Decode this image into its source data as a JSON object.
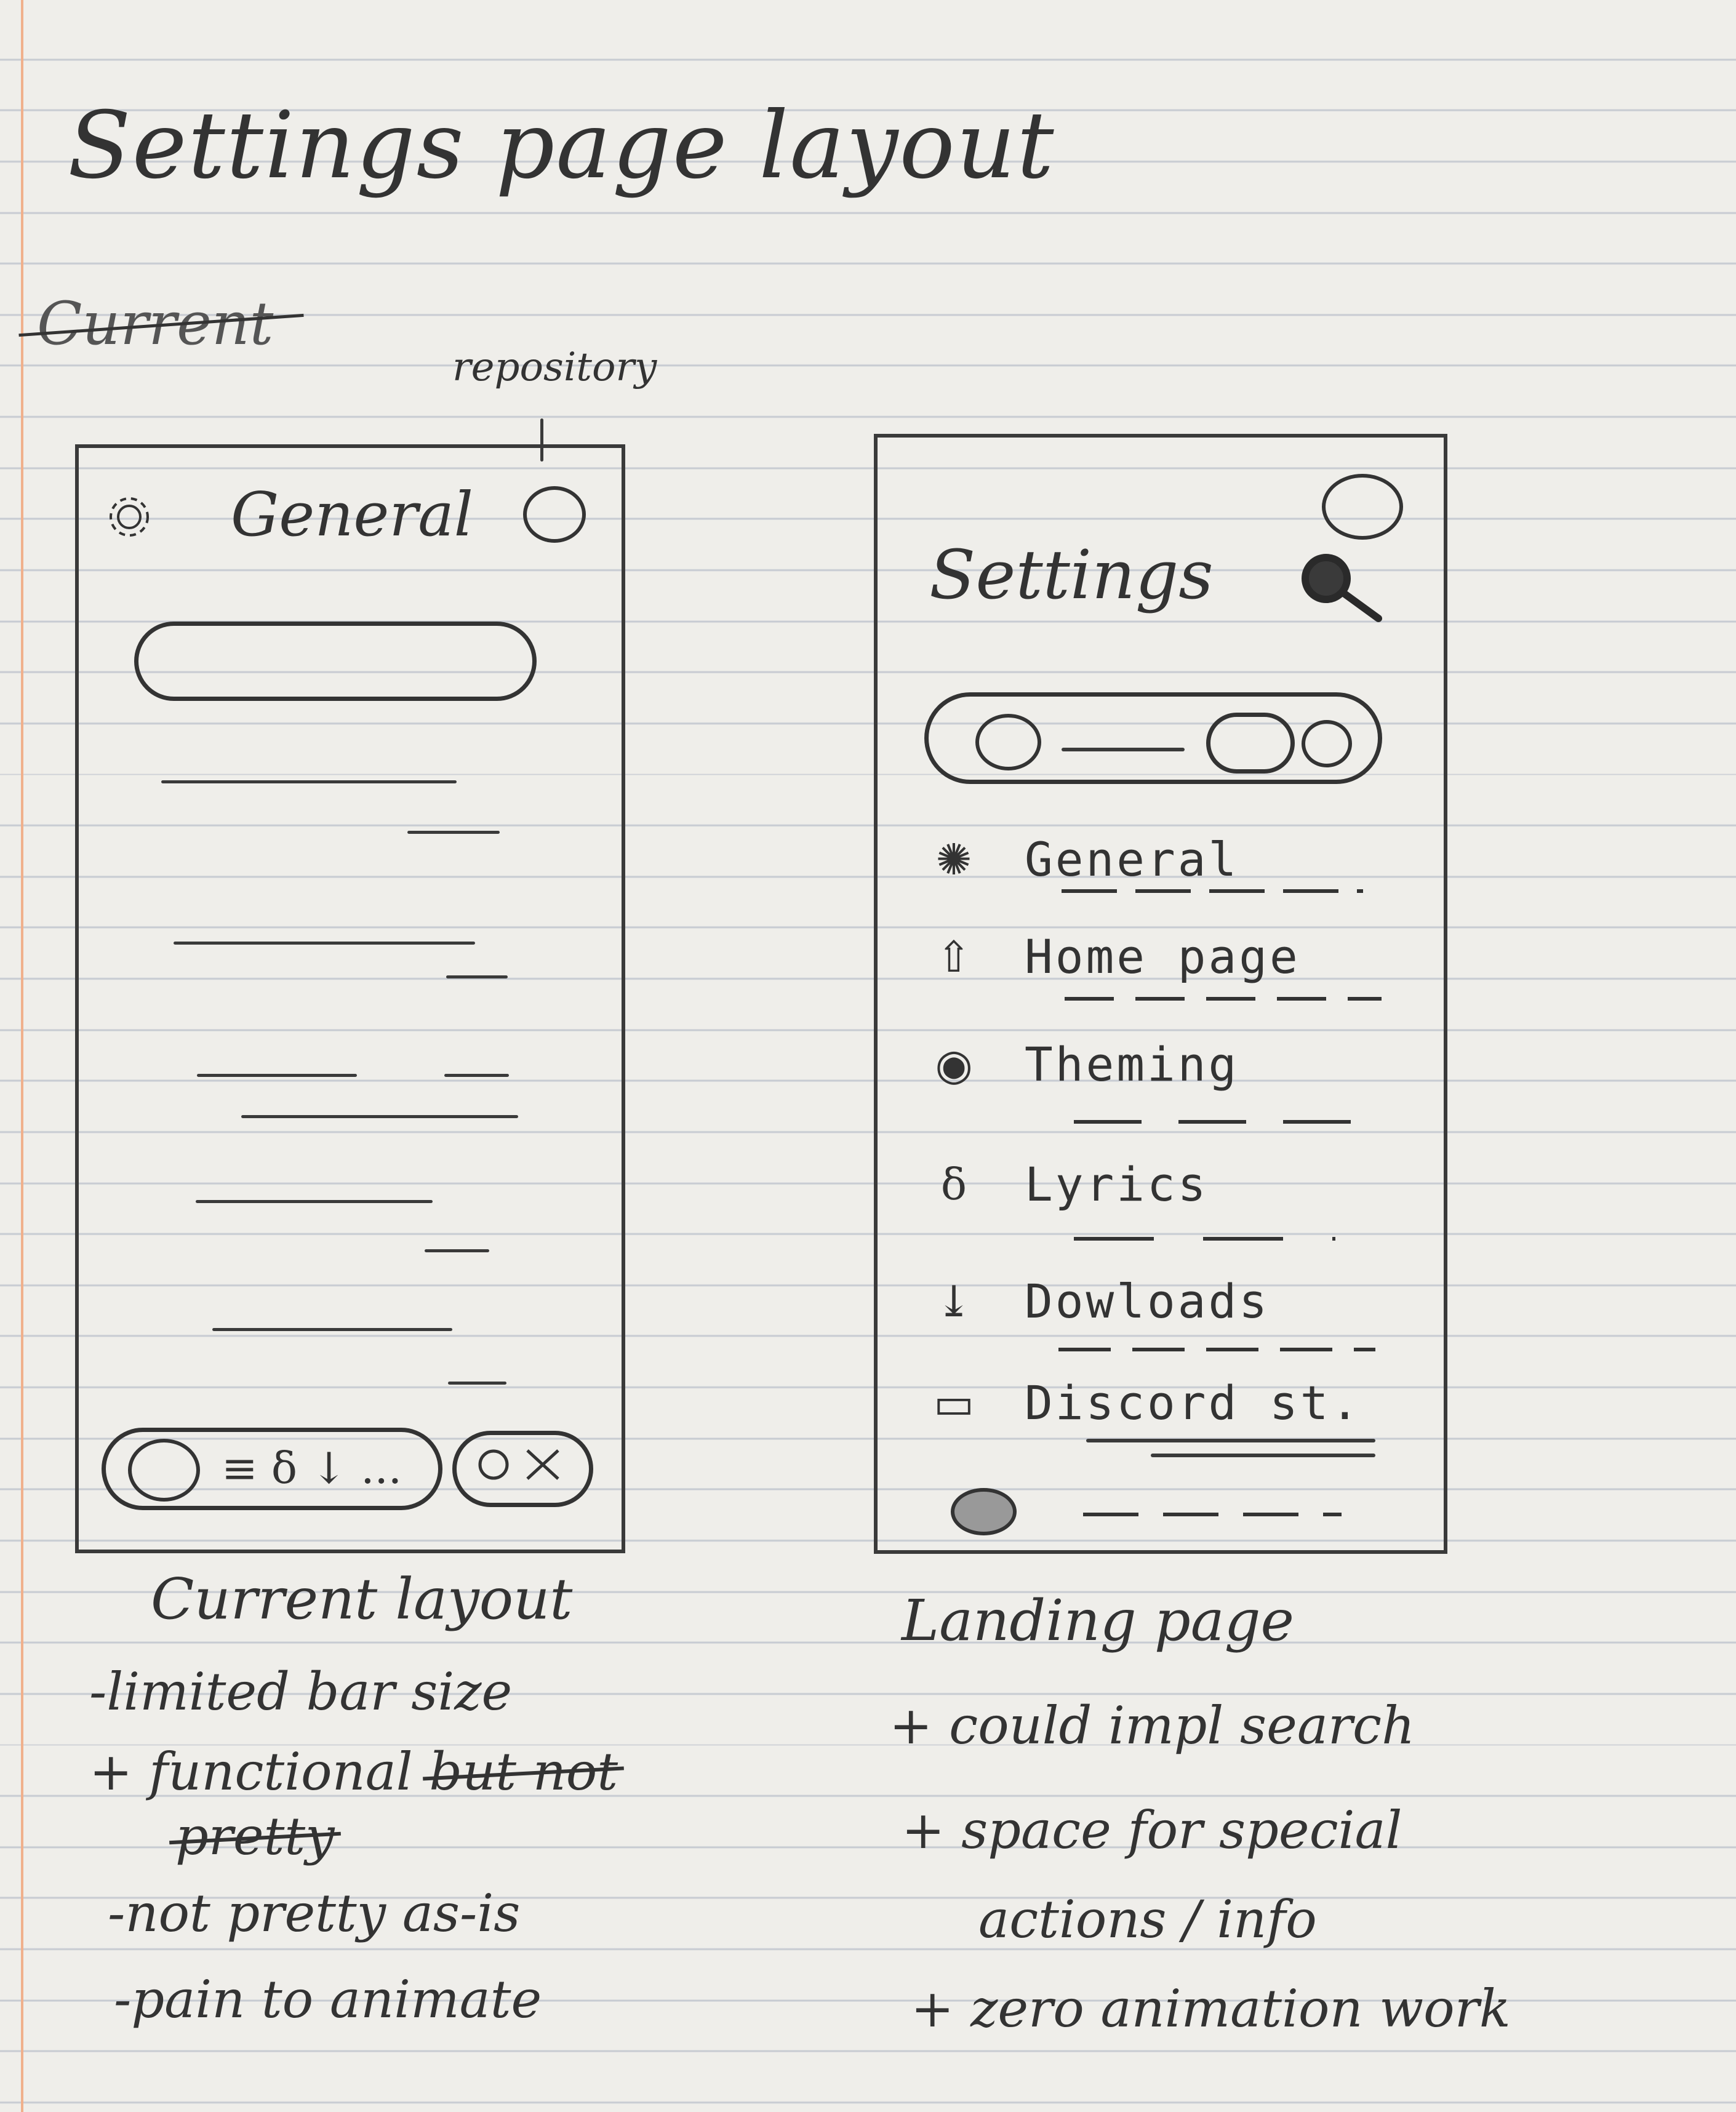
{
  "title": "Settings page layout",
  "struck_heading": "Current",
  "left_mockup": {
    "annotation": "repository",
    "header_label": "General",
    "bottom_bar_icons": "≡ δ ↓ ..."
  },
  "right_mockup": {
    "heading": "Settings",
    "menu_items": [
      {
        "label": "General",
        "icon": "gear-icon"
      },
      {
        "label": "Home page",
        "icon": "home-icon"
      },
      {
        "label": "Theming",
        "icon": "palette-icon"
      },
      {
        "label": "Lyrics",
        "icon": "music-note-icon"
      },
      {
        "label": "Dowloads",
        "icon": "download-icon"
      },
      {
        "label": "Discord st.",
        "icon": "discord-icon"
      }
    ]
  },
  "left_notes": {
    "caption": "Current layout",
    "lines": [
      "-limited bar size",
      "+ functional",
      "but not",
      "pretty",
      "-not pretty as-is",
      "-pain to animate"
    ]
  },
  "right_notes": {
    "caption": "Landing page",
    "lines": [
      "+ could impl search",
      "+ space for special",
      "actions / info",
      "+ zero animation work"
    ]
  }
}
